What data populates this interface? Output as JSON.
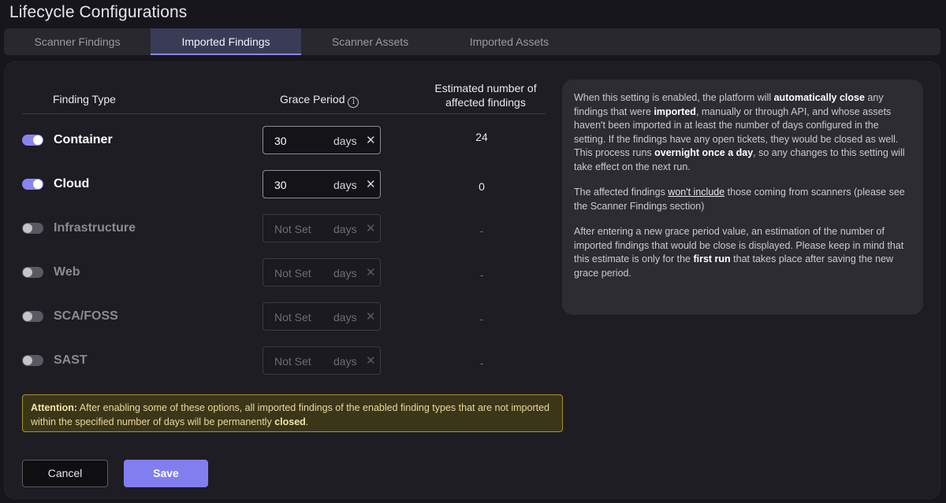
{
  "page": {
    "title": "Lifecycle Configurations"
  },
  "tabs": [
    {
      "label": "Scanner Findings",
      "active": false
    },
    {
      "label": "Imported Findings",
      "active": true
    },
    {
      "label": "Scanner Assets",
      "active": false
    },
    {
      "label": "Imported Assets",
      "active": false
    }
  ],
  "table": {
    "headers": {
      "finding_type": "Finding Type",
      "grace_period": "Grace Period",
      "estimated": "Estimated number of affected findings"
    },
    "rows": [
      {
        "label": "Container",
        "enabled": true,
        "value": "30",
        "unit": "days",
        "clear": "✕",
        "estimate": "24"
      },
      {
        "label": "Cloud",
        "enabled": true,
        "value": "30",
        "unit": "days",
        "clear": "✕",
        "estimate": "0"
      },
      {
        "label": "Infrastructure",
        "enabled": false,
        "value": "Not Set",
        "unit": "days",
        "clear": "✕",
        "estimate": "-"
      },
      {
        "label": "Web",
        "enabled": false,
        "value": "Not Set",
        "unit": "days",
        "clear": "✕",
        "estimate": "-"
      },
      {
        "label": "SCA/FOSS",
        "enabled": false,
        "value": "Not Set",
        "unit": "days",
        "clear": "✕",
        "estimate": "-"
      },
      {
        "label": "SAST",
        "enabled": false,
        "value": "Not Set",
        "unit": "days",
        "clear": "✕",
        "estimate": "-"
      }
    ]
  },
  "attention": {
    "prefix": "Attention:",
    "text1": " After enabling some of these options, all imported findings of the enabled finding types that are not imported within the specified number of days will be permanently ",
    "bold_end": "closed",
    "suffix": "."
  },
  "buttons": {
    "cancel": "Cancel",
    "save": "Save"
  },
  "help": {
    "p1_a": "When this setting is enabled, the platform will ",
    "p1_b": "automatically close",
    "p1_c": " any findings that were ",
    "p1_d": "imported",
    "p1_e": ", manually or through API, and whose assets haven't been imported in at least the number of days configured in the setting. If the findings have any open tickets, they would be closed as well.",
    "p1_f": "This process runs ",
    "p1_g": "overnight once a day",
    "p1_h": ", so any changes to this setting will take effect on the next run.",
    "p2_a": "The affected findings ",
    "p2_b": "won't include",
    "p2_c": " those coming from scanners (please see the Scanner Findings section)",
    "p3_a": "After entering a new grace period value, an estimation of the number of imported findings that would be close is displayed. Please keep in mind that this estimate is only for the ",
    "p3_b": "first run",
    "p3_c": " that takes place after saving the new grace period."
  },
  "colors": {
    "accent": "#837ef0",
    "toggle_on": "#8a84f0",
    "attention_bg": "#3b3618",
    "attention_border": "#a8942f"
  }
}
